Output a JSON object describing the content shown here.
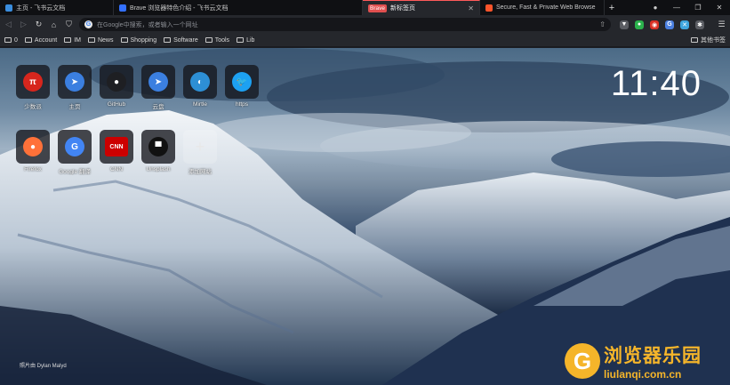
{
  "tabs": [
    {
      "title": "主页 - 飞书云文档",
      "favicon_color": "#3a8dde",
      "active": false
    },
    {
      "title": "Brave 浏览器特色介绍 - 飞书云文档",
      "favicon_color": "#3370ff",
      "active": false
    },
    {
      "badge": "Brave",
      "title": "新标签页",
      "active": true
    },
    {
      "title": "Secure, Fast & Private Web Browse",
      "favicon_color": "#fb542b",
      "active": false
    }
  ],
  "toolbar": {
    "address_placeholder": "在Google中搜索，或者输入一个网址",
    "extensions": [
      {
        "name": "brave-shield-icon",
        "color": "#5b5d63",
        "glyph": "▼"
      },
      {
        "name": "extension-green-icon",
        "color": "#2bb24c",
        "glyph": "●"
      },
      {
        "name": "extension-red-icon",
        "color": "#d93025",
        "glyph": "◉"
      },
      {
        "name": "translate-icon",
        "color": "#4a7fe0",
        "glyph": "G"
      },
      {
        "name": "extension-blue-icon",
        "color": "#3fa6de",
        "glyph": "✕"
      },
      {
        "name": "puzzle-icon",
        "color": "#5b5d63",
        "glyph": "✱"
      }
    ]
  },
  "bookmarks": {
    "items": [
      "0",
      "Account",
      "IM",
      "News",
      "Shopping",
      "Software",
      "Tools",
      "Lib"
    ],
    "other": "其他书签"
  },
  "newtab": {
    "clock": "11:40",
    "credit": "照片由 Dylan Malyd",
    "tiles": [
      {
        "label": "少数派",
        "icon": "π",
        "bg": "#d7261d",
        "name": "sspai-tile"
      },
      {
        "label": "主页",
        "icon": "➤",
        "bg": "#3b7fe0",
        "name": "feishu-home-tile"
      },
      {
        "label": "GitHub",
        "icon": "●",
        "bg": "#1e1f23",
        "name": "github-tile"
      },
      {
        "label": "云盘",
        "icon": "➤",
        "bg": "#3b7fe0",
        "name": "feishu-drive-tile"
      },
      {
        "label": "Mirtle",
        "icon": "◐",
        "bg": "#2d8fd5",
        "name": "mirtle-tile"
      },
      {
        "label": "https",
        "icon": "🐦",
        "bg": "#1da1f2",
        "name": "twitter-tile"
      },
      {
        "label": "Firefox",
        "icon": "●",
        "bg": "#ff7139",
        "name": "firefox-tile"
      },
      {
        "label": "Google 翻译",
        "icon": "G",
        "bg": "#4285f4",
        "name": "google-translate-tile"
      },
      {
        "label": "CNN",
        "icon": "CNN",
        "bg": "#cc0000",
        "name": "cnn-tile"
      },
      {
        "label": "Unsplash",
        "icon": "▀",
        "bg": "#111111",
        "name": "unsplash-tile"
      },
      {
        "label": "添加网站",
        "icon": "+",
        "bg": "",
        "name": "add-site-tile"
      }
    ]
  },
  "watermark": {
    "cn": "浏览器乐园",
    "en": "liulanqi.com.cn",
    "logo": "G",
    "color": "#f5b52a"
  }
}
